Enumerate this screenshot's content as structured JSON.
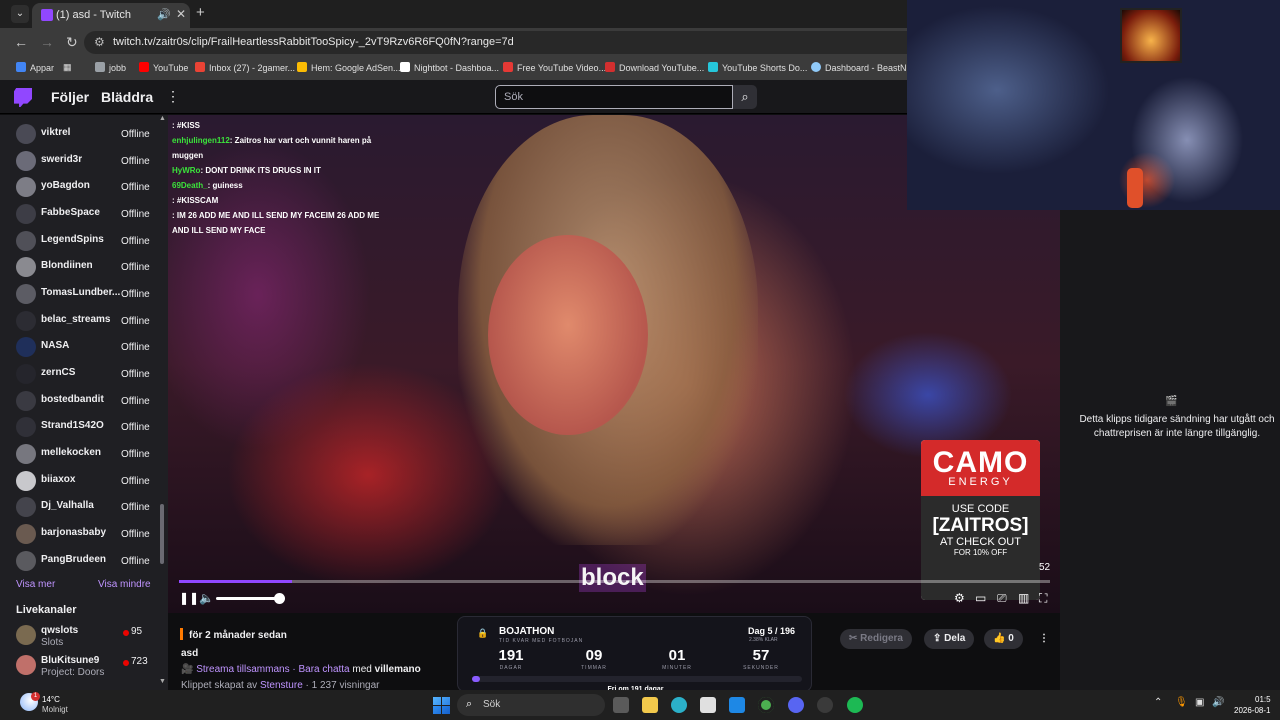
{
  "browser": {
    "tab_title": "(1) asd - Twitch",
    "url": "twitch.tv/zaitr0s/clip/FrailHeartlessRabbitTooSpicy-_2vT9Rzv6R6FQ0fN?range=7d",
    "bookmarks": [
      {
        "label": "Appar",
        "color": "#4285f4"
      },
      {
        "label": "jobb",
        "color": "#9aa0a6"
      },
      {
        "label": "YouTube",
        "color": "#ff0000"
      },
      {
        "label": "Inbox (27) - 2gamer...",
        "color": "#ea4335"
      },
      {
        "label": "Hem: Google AdSen...",
        "color": "#fbbc04"
      },
      {
        "label": "Nightbot - Dashboa...",
        "color": "#ffffff"
      },
      {
        "label": "Free YouTube Video...",
        "color": "#e53935"
      },
      {
        "label": "Download YouTube...",
        "color": "#d32f2f"
      },
      {
        "label": "YouTube Shorts Do...",
        "color": "#26c6da"
      },
      {
        "label": "Dashboard - BeastN...",
        "color": "#90caf9"
      }
    ]
  },
  "header": {
    "following": "Följer",
    "browse": "Bläddra",
    "search_placeholder": "Sök",
    "accent": "#9147ff"
  },
  "sidebar": {
    "channels": [
      {
        "name": "viktrel",
        "status": "Offline"
      },
      {
        "name": "swerid3r",
        "status": "Offline"
      },
      {
        "name": "yoBagdon",
        "status": "Offline"
      },
      {
        "name": "FabbeSpace",
        "status": "Offline"
      },
      {
        "name": "LegendSpins",
        "status": "Offline"
      },
      {
        "name": "Blondiinen",
        "status": "Offline"
      },
      {
        "name": "TomasLundber...",
        "status": "Offline"
      },
      {
        "name": "belac_streams",
        "status": "Offline"
      },
      {
        "name": "NASA",
        "status": "Offline"
      },
      {
        "name": "zernCS",
        "status": "Offline"
      },
      {
        "name": "bostedbandit",
        "status": "Offline"
      },
      {
        "name": "Strand1S42O",
        "status": "Offline"
      },
      {
        "name": "mellekocken",
        "status": "Offline"
      },
      {
        "name": "biiaxox",
        "status": "Offline"
      },
      {
        "name": "Dj_Valhalla",
        "status": "Offline"
      },
      {
        "name": "barjonasbaby",
        "status": "Offline"
      },
      {
        "name": "PangBrudeen",
        "status": "Offline"
      }
    ],
    "show_more": "Visa mer",
    "show_less": "Visa mindre",
    "live_header": "Livekanaler",
    "live_channels": [
      {
        "name": "qwslots",
        "game": "Slots",
        "viewers": "95",
        "color": "#7a6a50"
      },
      {
        "name": "BluKitsune9",
        "game": "Project: Doors",
        "viewers": "723",
        "color": "#c0706a"
      }
    ]
  },
  "video": {
    "chat_lines": [
      {
        "user": "",
        "text": ": #KISS"
      },
      {
        "user": "enhjulingen112",
        "text": ": Zaitros har vart och vunnit haren på muggen"
      },
      {
        "user": "HyWRo",
        "text": ": DONT DRINK ITS DRUGS IN IT"
      },
      {
        "user": "69Death_",
        "text": ": guiness"
      },
      {
        "user": "",
        "text": ": #KISSCAM"
      },
      {
        "user": "",
        "text": ": IM 26 ADD ME AND ILL SEND MY FACEIM 26 ADD ME AND ILL SEND MY FACE"
      }
    ],
    "caption": "block",
    "progress": 0.13,
    "volume": 0.9,
    "timer": "52"
  },
  "ad": {
    "brand": "CAMO",
    "sub": "ENERGY",
    "line1": "USE CODE",
    "code": "[ZAITROS]",
    "line3": "AT CHECK OUT",
    "line4": "FOR 10% OFF"
  },
  "chat_panel": {
    "message": "Detta klipps tidigare sändning har utgått och chattreprisen är inte längre tillgänglig."
  },
  "clip_info": {
    "time_ago": "för 2 månader sedan",
    "title": "asd",
    "category_line": "Streama tillsammans · Bara chatta",
    "with": "med",
    "with_user": "villemano",
    "creator_prefix": "Klippet skapat av",
    "creator": "Stensture",
    "views": "· 1 237 visningar",
    "edit": "Redigera",
    "share": "Dela",
    "likes": "0"
  },
  "bojathon": {
    "title": "BOJATHON",
    "subtitle": "TID KVAR MED FOTBOJAN",
    "day": "Dag 5 / 196",
    "percent": "2.38% KLAR",
    "days": "191",
    "days_label": "DAGAR",
    "hours": "09",
    "hours_label": "TIMMAR",
    "minutes": "01",
    "minutes_label": "MINUTER",
    "seconds": "57",
    "seconds_label": "SEKUNDER",
    "progress": 0.0238,
    "free_text": "Fri om 191 dagar"
  },
  "taskbar": {
    "temp": "14°C",
    "condition": "Molnigt",
    "badge": "1",
    "search": "Sök",
    "clock": "01:5",
    "date": "2026-08-1"
  }
}
